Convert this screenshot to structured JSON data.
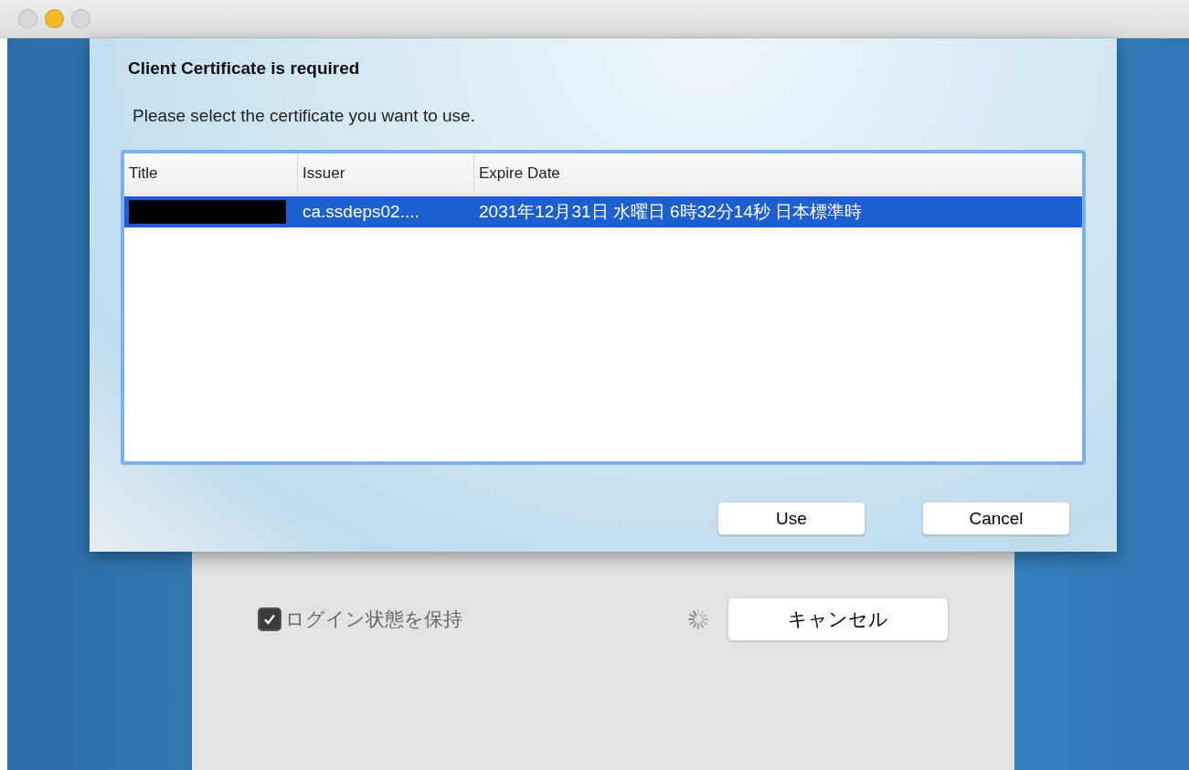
{
  "window": {
    "buttons": [
      {
        "kind": "close",
        "active": false
      },
      {
        "kind": "minimize",
        "active": true
      },
      {
        "kind": "zoom",
        "active": false
      }
    ]
  },
  "dialog": {
    "title": "Client Certificate is required",
    "message": "Please select the certificate you want to use.",
    "table": {
      "columns": [
        "Title",
        "Issuer",
        "Expire Date"
      ],
      "rows": [
        {
          "title_redacted": true,
          "issuer": "ca.ssdeps02....",
          "expire_date": "2031年12月31日 水曜日 6時32分14秒 日本標準時",
          "selected": true
        }
      ]
    },
    "buttons": [
      "Use",
      "Cancel"
    ]
  },
  "login": {
    "keep_logged_in": {
      "label": "ログイン状態を保持",
      "checked": true
    },
    "loading": true,
    "cancel_button": "キャンセル"
  }
}
